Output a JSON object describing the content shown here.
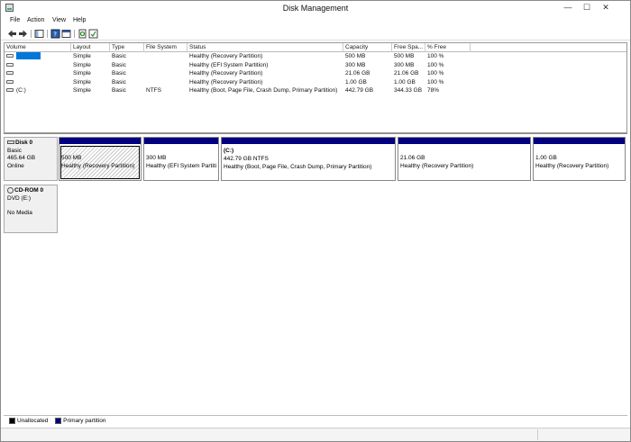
{
  "window": {
    "title": "Disk Management",
    "controls": {
      "minimize": "—",
      "maximize": "☐",
      "close": "✕"
    }
  },
  "menu": [
    "File",
    "Action",
    "View",
    "Help"
  ],
  "toolbar": [
    "back",
    "forward",
    "show-hide-console-tree",
    "help",
    "properties",
    "refresh",
    "export-list"
  ],
  "volume_list": {
    "columns": [
      "Volume",
      "Layout",
      "Type",
      "File System",
      "Status",
      "Capacity",
      "Free Spa...",
      "% Free"
    ],
    "rows": [
      {
        "volume": "",
        "layout": "Simple",
        "type": "Basic",
        "fs": "",
        "status": "Healthy (Recovery Partition)",
        "capacity": "500 MB",
        "free": "500 MB",
        "pct": "100 %",
        "selected": true
      },
      {
        "volume": "",
        "layout": "Simple",
        "type": "Basic",
        "fs": "",
        "status": "Healthy (EFI System Partition)",
        "capacity": "300 MB",
        "free": "300 MB",
        "pct": "100 %"
      },
      {
        "volume": "",
        "layout": "Simple",
        "type": "Basic",
        "fs": "",
        "status": "Healthy (Recovery Partition)",
        "capacity": "21.06 GB",
        "free": "21.06 GB",
        "pct": "100 %"
      },
      {
        "volume": "",
        "layout": "Simple",
        "type": "Basic",
        "fs": "",
        "status": "Healthy (Recovery Partition)",
        "capacity": "1.00 GB",
        "free": "1.00 GB",
        "pct": "100 %"
      },
      {
        "volume": "(C:)",
        "layout": "Simple",
        "type": "Basic",
        "fs": "NTFS",
        "status": "Healthy (Boot, Page File, Crash Dump, Primary Partition)",
        "capacity": "442.79 GB",
        "free": "344.33 GB",
        "pct": "78%"
      }
    ]
  },
  "disks": [
    {
      "name": "Disk 0",
      "type": "Basic",
      "size": "465.64 GB",
      "state": "Online",
      "partitions": [
        {
          "drive": "",
          "size": "500 MB",
          "status": "Healthy (Recovery Partition)",
          "selected": true
        },
        {
          "drive": "",
          "size": "300 MB",
          "status": "Healthy (EFI System Partiti"
        },
        {
          "drive": "(C:)",
          "size": "442.79 GB NTFS",
          "status": "Healthy (Boot, Page File, Crash Dump, Primary Partition)"
        },
        {
          "drive": "",
          "size": "21.06 GB",
          "status": "Healthy (Recovery Partition)"
        },
        {
          "drive": "",
          "size": "1.00 GB",
          "status": "Healthy (Recovery Partition)"
        }
      ]
    },
    {
      "name": "CD-ROM 0",
      "type": "DVD (E:)",
      "size": "",
      "state": "No Media",
      "partitions": []
    }
  ],
  "legend": [
    {
      "label": "Unallocated",
      "color": "#000000"
    },
    {
      "label": "Primary partition",
      "color": "#000080"
    }
  ]
}
